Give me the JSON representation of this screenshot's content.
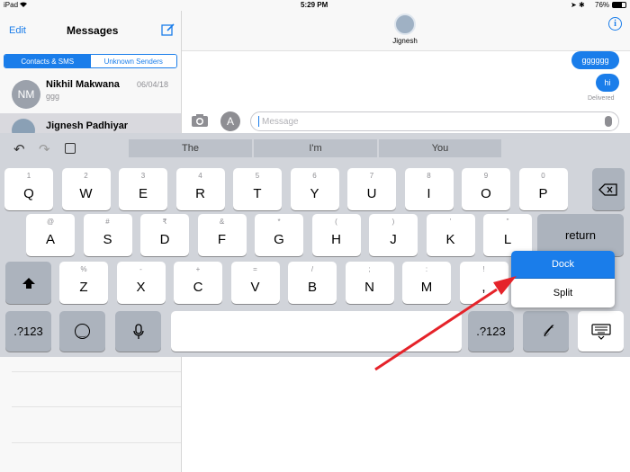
{
  "status": {
    "device": "iPad",
    "time": "5:29 PM",
    "battery": "76%"
  },
  "sidebar": {
    "edit": "Edit",
    "title": "Messages",
    "tabs": [
      "Contacts & SMS",
      "Unknown Senders"
    ],
    "conversations": [
      {
        "initials": "NM",
        "name": "Nikhil Makwana",
        "date": "06/04/18",
        "preview": "ggg"
      },
      {
        "name": "Jignesh Padhiyar"
      }
    ]
  },
  "chat": {
    "contact": "Jignesh",
    "messages": [
      "gggggg",
      "hi"
    ],
    "delivered": "Delivered",
    "placeholder": "Message"
  },
  "keyboard": {
    "suggestions": [
      "The",
      "I'm",
      "You"
    ],
    "row1": [
      [
        "1",
        "Q"
      ],
      [
        "2",
        "W"
      ],
      [
        "3",
        "E"
      ],
      [
        "4",
        "R"
      ],
      [
        "5",
        "T"
      ],
      [
        "6",
        "Y"
      ],
      [
        "7",
        "U"
      ],
      [
        "8",
        "I"
      ],
      [
        "9",
        "O"
      ],
      [
        "0",
        "P"
      ]
    ],
    "row2": [
      [
        "@",
        "A"
      ],
      [
        "#",
        "S"
      ],
      [
        "₹",
        "D"
      ],
      [
        "&",
        "F"
      ],
      [
        "*",
        "G"
      ],
      [
        "(",
        "H"
      ],
      [
        ")",
        "J"
      ],
      [
        "'",
        "K"
      ],
      [
        "\"",
        "L"
      ]
    ],
    "row3": [
      [
        "%",
        "Z"
      ],
      [
        "-",
        "X"
      ],
      [
        "+",
        "C"
      ],
      [
        "=",
        "V"
      ],
      [
        "/",
        "B"
      ],
      [
        ";",
        "N"
      ],
      [
        ":",
        "M"
      ],
      [
        "!",
        ","
      ]
    ],
    "return": "return",
    "numbers": ".?123",
    "popup": {
      "dock": "Dock",
      "split": "Split"
    },
    "annotation_color": "#e5232a"
  }
}
